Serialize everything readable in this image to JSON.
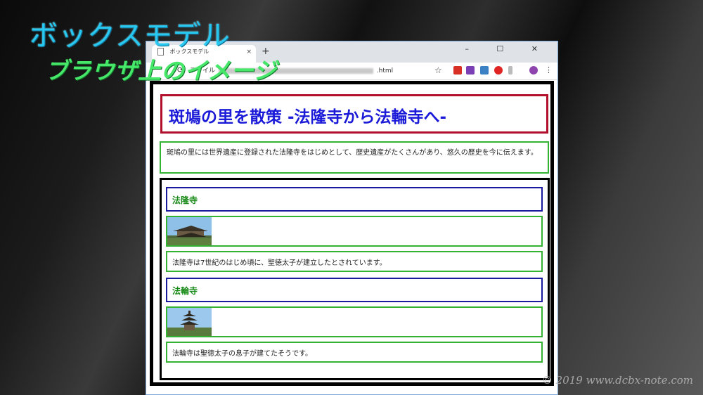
{
  "overlay": {
    "title": "ボックスモデル",
    "subtitle": "ブラウザ上のイメージ",
    "copyright": "© 2019 www.dcbx-note.com"
  },
  "browser": {
    "tab_title": "ボックスモデル",
    "tab_close": "×",
    "new_tab": "+",
    "window_controls": "–  ☐  ✕",
    "url_prefix": "ファイル",
    "url_suffix": ".html",
    "star_icon": "☆"
  },
  "page": {
    "h1": "斑鳩の里を散策 -法隆寺から法輪寺へ-",
    "intro": "斑鳩の里には世界遺産に登録された法隆寺をはじめとして、歴史遺産がたくさんがあり、悠久の歴史を今に伝えます。",
    "sections": [
      {
        "heading": "法隆寺",
        "text": "法隆寺は7世紀のはじめ頃に、聖徳太子が建立したとされています。"
      },
      {
        "heading": "法輪寺",
        "text": "法輪寺は聖徳太子の息子が建てたそうです。"
      }
    ]
  },
  "colors": {
    "h1_border": "#b0102a",
    "h1_text": "#1a1ad8",
    "h2_border": "#1a1aa0",
    "h2_text": "#178a17",
    "box_green": "#33b233"
  }
}
